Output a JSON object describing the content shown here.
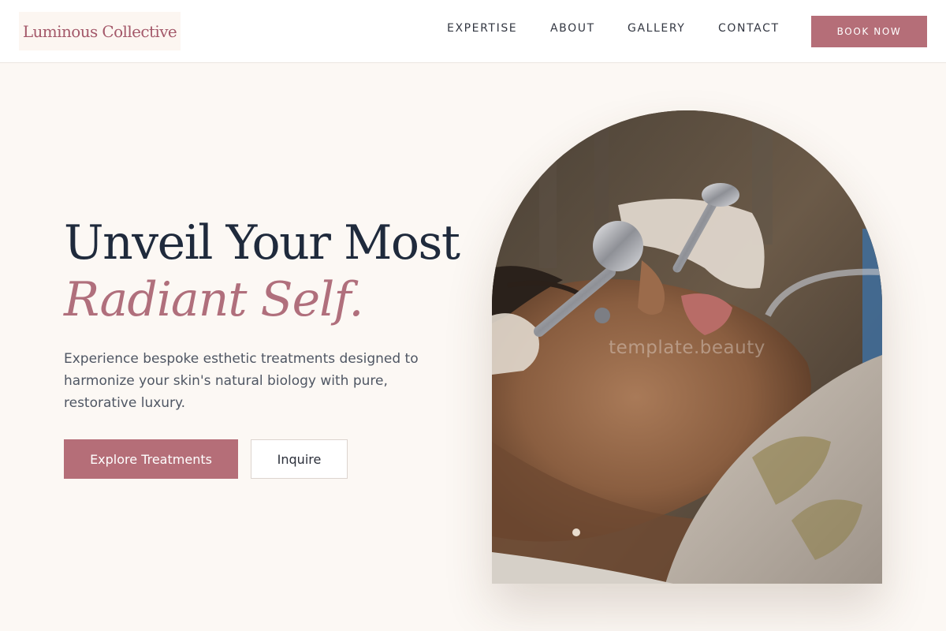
{
  "header": {
    "logo": "Luminous Collective",
    "nav": [
      "EXPERTISE",
      "ABOUT",
      "GALLERY",
      "CONTACT"
    ],
    "cta_label": "BOOK NOW"
  },
  "hero": {
    "title_line1": "Unveil Your Most",
    "title_line2": "Radiant Self.",
    "description": "Experience bespoke esthetic treatments designed to harmonize your skin's natural biology with pure, restorative luxury.",
    "primary_button": "Explore Treatments",
    "secondary_button": "Inquire",
    "image_watermark": "template.beauty"
  },
  "colors": {
    "accent": "#b56e78",
    "heading": "#1f2a3c",
    "background": "#fcf8f4"
  }
}
